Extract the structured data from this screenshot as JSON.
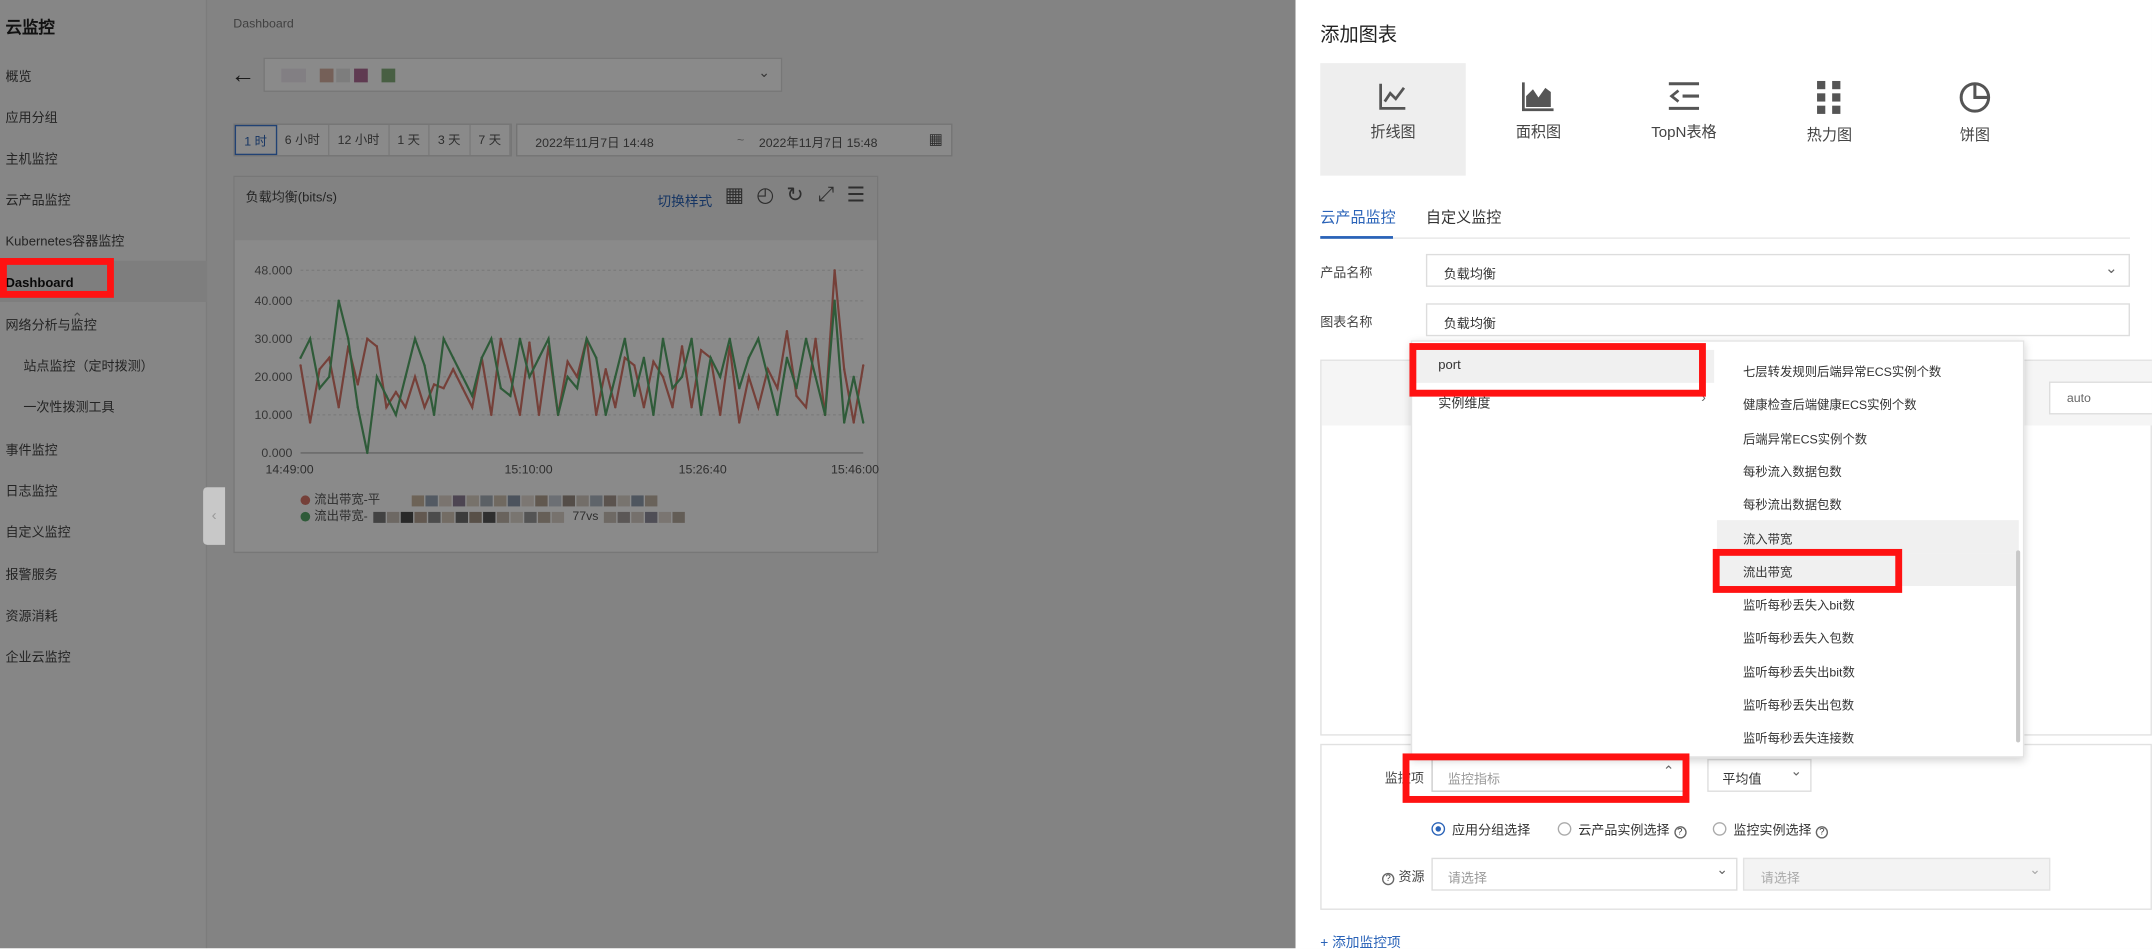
{
  "sidebar": {
    "title": "云监控",
    "items": [
      {
        "label": "概览",
        "chevron": false
      },
      {
        "label": "应用分组",
        "chevron": false
      },
      {
        "label": "主机监控",
        "chevron": false
      },
      {
        "label": "云产品监控",
        "chevron": false
      },
      {
        "label": "Kubernetes容器监控",
        "chevron": false
      },
      {
        "label": "Dashboard",
        "chevron": false,
        "active": true
      },
      {
        "label": "网络分析与监控",
        "chevron": true
      },
      {
        "label": "站点监控（定时拨测）",
        "chevron": false,
        "sub": true
      },
      {
        "label": "一次性拨测工具",
        "chevron": false,
        "sub": true
      },
      {
        "label": "事件监控",
        "chevron": true
      },
      {
        "label": "日志监控",
        "chevron": false
      },
      {
        "label": "自定义监控",
        "chevron": false
      },
      {
        "label": "报警服务",
        "chevron": true
      },
      {
        "label": "资源消耗",
        "chevron": false
      },
      {
        "label": "企业云监控",
        "chevron": true
      }
    ]
  },
  "main": {
    "breadcrumb": "Dashboard",
    "back_icon": "arrow-left-icon",
    "time_buttons": [
      "1 时",
      "6 小时",
      "12 小时",
      "1 天",
      "3 天",
      "7 天"
    ],
    "active_time": 0,
    "date_start": "2022年11月7日 14:48",
    "date_end": "2022年11月7日 15:48",
    "calendar_icon": "calendar-icon"
  },
  "chart_card": {
    "title": "负载均衡(bits/s)",
    "switch_label": "切换样式",
    "icons": [
      "calendar-icon",
      "clock-icon",
      "refresh-icon",
      "expand-icon",
      "menu-icon"
    ],
    "legend": [
      {
        "label": "流出带宽-平",
        "color": "#d9776a"
      },
      {
        "label": "流出带宽-",
        "suffix": "77vs",
        "color": "#57a86a"
      }
    ]
  },
  "chart_data": {
    "type": "line",
    "yticks": [
      "0.000",
      "10.000",
      "20.000",
      "30.000",
      "40.000",
      "48.000"
    ],
    "ylim": [
      0,
      48
    ],
    "xticks": [
      "14:49:00",
      "15:10:00",
      "15:26:40",
      "15:46:00"
    ],
    "series": [
      {
        "color": "#d9776a",
        "values": [
          23,
          8,
          22,
          25,
          12,
          28,
          18,
          30,
          28,
          12,
          16,
          12,
          20,
          12,
          18,
          17,
          22,
          17,
          12,
          25,
          10,
          30,
          20,
          10,
          29,
          10,
          28,
          10,
          24,
          20,
          30,
          10,
          22,
          12,
          25,
          23,
          12,
          24,
          20,
          12,
          28,
          12,
          27,
          25,
          10,
          28,
          8,
          20,
          12,
          22,
          17,
          32,
          15,
          12,
          30,
          10,
          48,
          22,
          8,
          23
        ]
      },
      {
        "color": "#57a86a",
        "values": [
          25,
          30,
          17,
          20,
          40,
          30,
          12,
          0,
          20,
          15,
          10,
          20,
          30,
          23,
          10,
          30,
          25,
          20,
          15,
          25,
          30,
          17,
          15,
          30,
          20,
          25,
          30,
          10,
          20,
          17,
          30,
          25,
          10,
          20,
          30,
          15,
          25,
          10,
          30,
          17,
          20,
          30,
          10,
          25,
          20,
          30,
          17,
          25,
          30,
          20,
          10,
          25,
          17,
          30,
          20,
          10,
          40,
          8,
          20,
          8
        ]
      }
    ]
  },
  "drawer": {
    "title": "添加图表",
    "chart_types": [
      {
        "label": "折线图",
        "icon": "line-chart-icon"
      },
      {
        "label": "面积图",
        "icon": "area-chart-icon"
      },
      {
        "label": "TopN表格",
        "icon": "topn-table-icon"
      },
      {
        "label": "热力图",
        "icon": "heatmap-icon"
      },
      {
        "label": "饼图",
        "icon": "pie-chart-icon"
      }
    ],
    "tabs": [
      "云产品监控",
      "自定义监控"
    ],
    "product_label": "产品名称",
    "product_value": "负载均衡",
    "chart_name_label": "图表名称",
    "chart_name_value": "负载均衡",
    "auto_value": "auto",
    "monitor_label": "监控项",
    "monitor_placeholder": "监控指标",
    "agg_value": "平均值",
    "radio_options": [
      "应用分组选择",
      "云产品实例选择",
      "监控实例选择"
    ],
    "resource_label": "资源",
    "resource_placeholder": "请选择",
    "resource_placeholder2": "请选择",
    "add_link": "+ 添加监控项"
  },
  "cascader": {
    "col1": [
      "port",
      "实例维度"
    ],
    "col2": [
      "七层转发规则后端异常ECS实例个数",
      "健康检查后端健康ECS实例个数",
      "后端异常ECS实例个数",
      "每秒流入数据包数",
      "每秒流出数据包数",
      "流入带宽",
      "流出带宽",
      "监听每秒丢失入bit数",
      "监听每秒丢失入包数",
      "监听每秒丢失出bit数",
      "监听每秒丢失出包数",
      "监听每秒丢失连接数"
    ]
  }
}
